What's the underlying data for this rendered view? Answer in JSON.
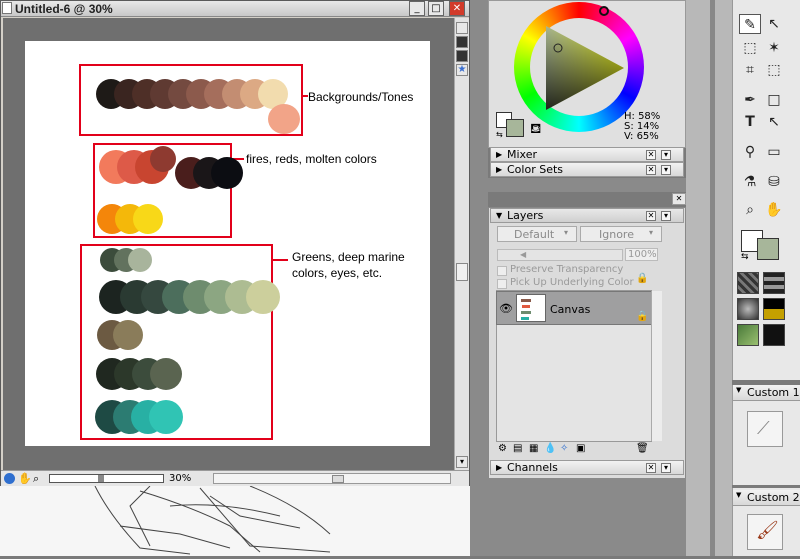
{
  "document": {
    "title": "Untitled-6 @ 30%",
    "zoom": "30%",
    "window_buttons": {
      "minimize": "_",
      "maximize": "□",
      "close": "✕"
    }
  },
  "annotations": {
    "backgrounds": "Backgrounds/Tones",
    "fires": "fires, reds, molten colors",
    "greens_line1": "Greens, deep marine",
    "greens_line2": "colors, eyes, etc."
  },
  "palette": {
    "backgrounds": [
      "#1e1a17",
      "#3a2520",
      "#4e2f27",
      "#5f3a32",
      "#744a40",
      "#8c5a4c",
      "#a56e5c",
      "#c38d72",
      "#dca984",
      "#f2dcae",
      "#f2a488"
    ],
    "fires_row1": [
      "#f27a5c",
      "#dd5a48",
      "#c84530",
      "#8e3a30",
      "#4a1e1c",
      "#1a1618",
      "#0c0d12"
    ],
    "fires_row2": [
      "#f4860a",
      "#f4b80a",
      "#f8d818"
    ],
    "greens_row1": [
      "#3c4c3c",
      "#62725e",
      "#a8b49c"
    ],
    "greens_row2": [
      "#1c2420",
      "#2a3a32",
      "#35483f",
      "#4c6e5c",
      "#6e8c6e",
      "#8ca682",
      "#adbc92",
      "#cccf9c"
    ],
    "greens_row3": [
      "#6c5a42",
      "#8a7c5a"
    ],
    "greens_row4": [
      "#202820",
      "#2c382a",
      "#3c4c3c",
      "#5a6450"
    ],
    "greens_row5": [
      "#1e4a44",
      "#2c7c72",
      "#28b0a4",
      "#30c4b4"
    ],
    "accent_red": "#e2001a"
  },
  "color_panel": {
    "hsv_h": "H: 58%",
    "hsv_s": "S: 14%",
    "hsv_v": "V: 65%",
    "foreground_color": "#a7b69a",
    "background_color": "#ffffff"
  },
  "panels": {
    "mixer": "Mixer",
    "color_sets": "Color Sets",
    "layers": "Layers",
    "channels": "Channels"
  },
  "layers": {
    "composite_method": "Default",
    "preserve_option": "Ignore",
    "opacity": "100%",
    "preserve_transparency": "Preserve Transparency",
    "pick_up_underlying": "Pick Up Underlying Color",
    "layer_name": "Canvas"
  },
  "tools": {
    "custom1": "Custom 1",
    "custom2": "Custom 2"
  }
}
